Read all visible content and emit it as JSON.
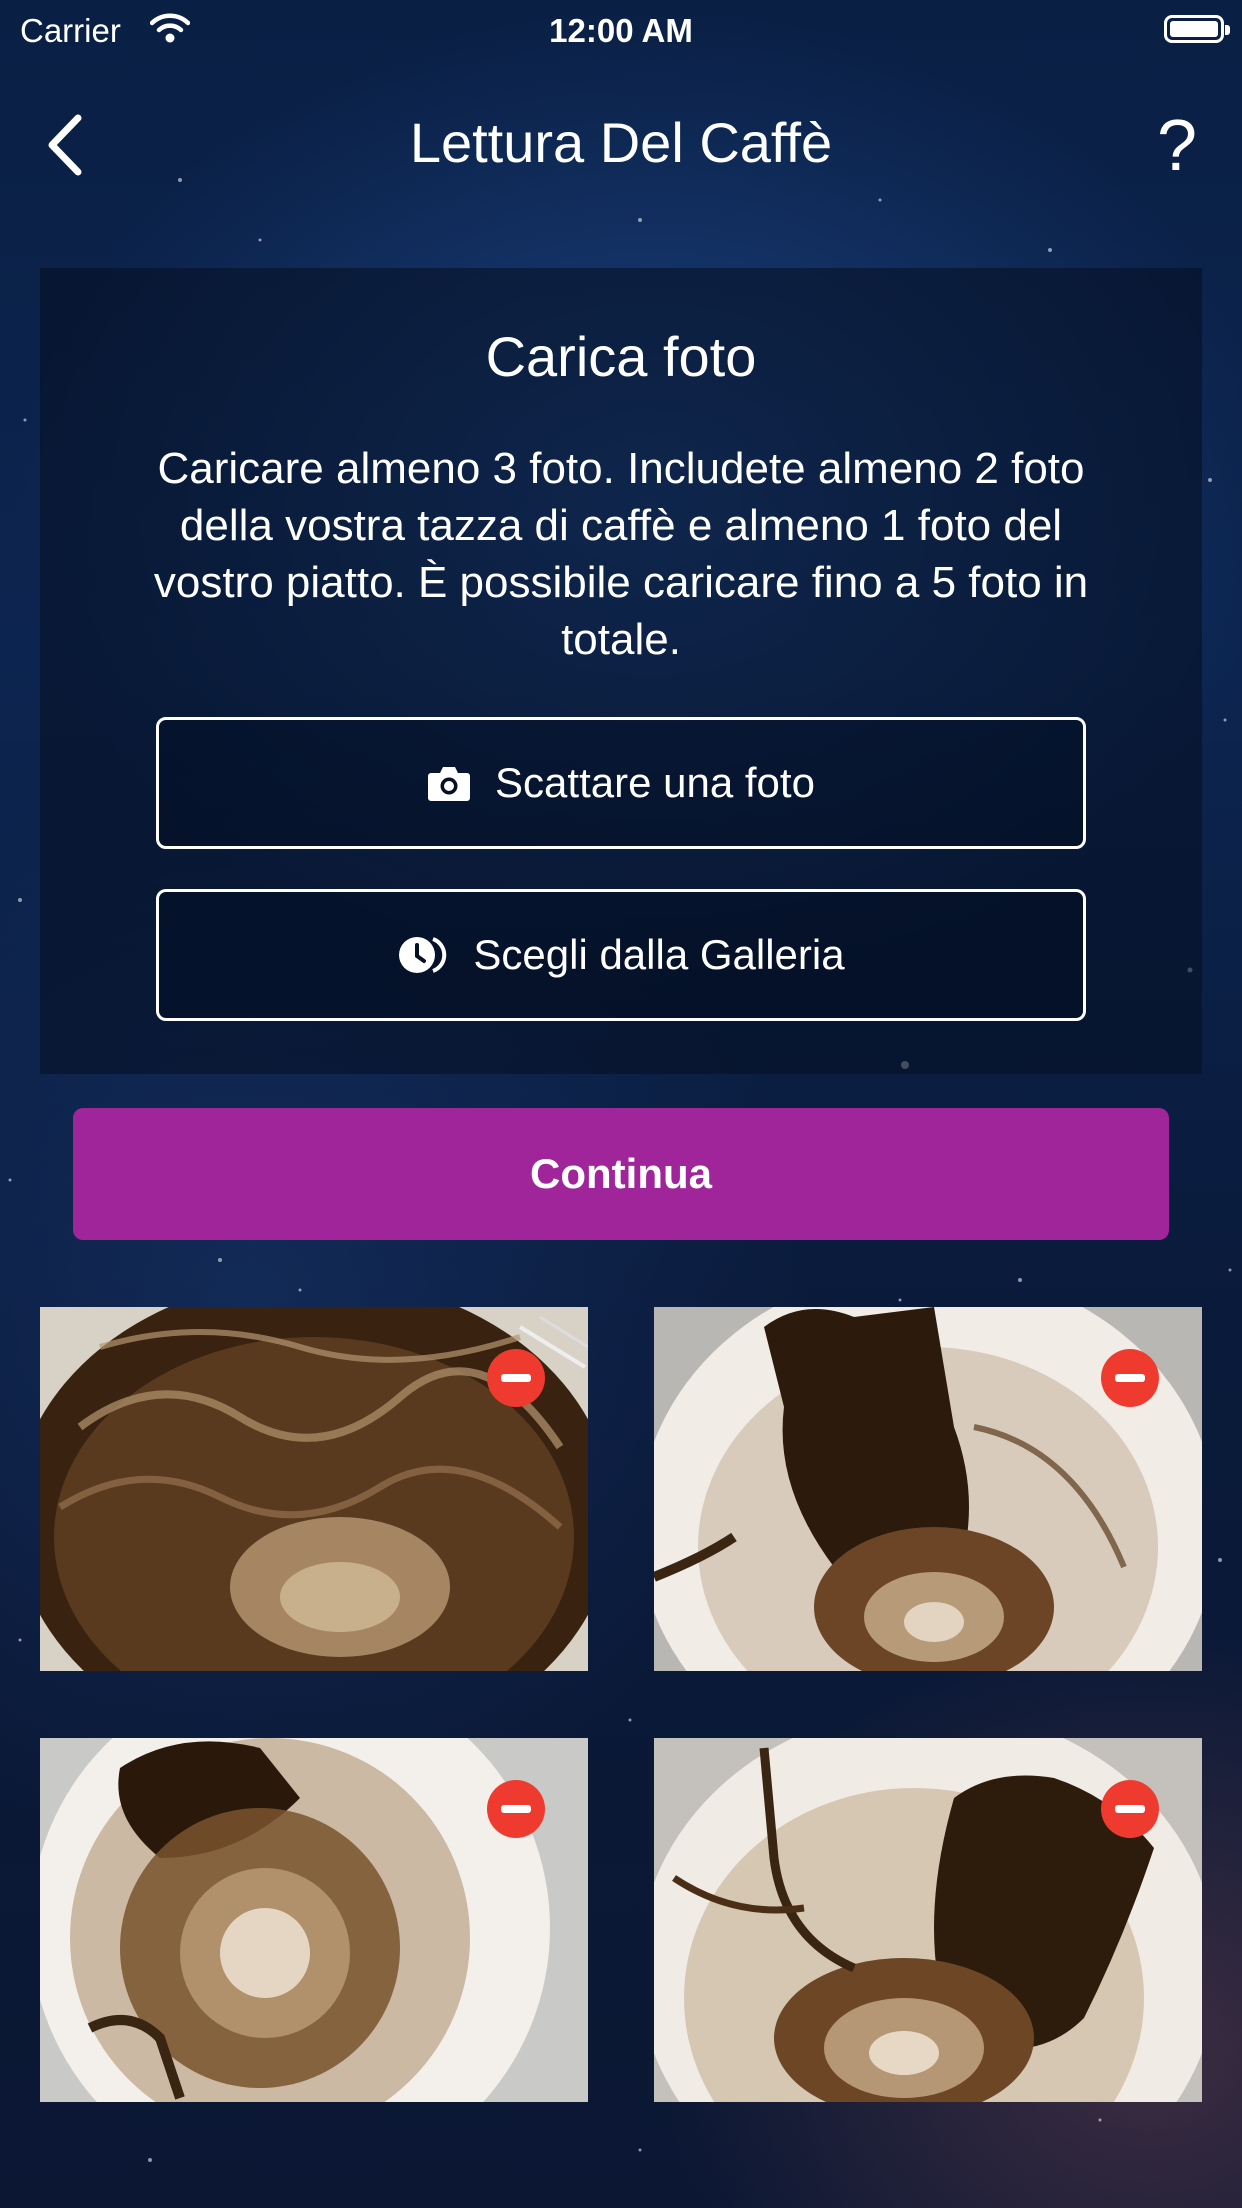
{
  "status_bar": {
    "carrier": "Carrier",
    "time": "12:00 AM"
  },
  "nav": {
    "title": "Lettura Del Caffè",
    "help_label": "?"
  },
  "upload": {
    "title": "Carica foto",
    "description": "Caricare almeno 3 foto. Includete almeno 2 foto della vostra tazza di caffè e almeno 1 foto del vostro piatto. È possibile caricare fino a 5 foto in totale.",
    "take_photo_label": "Scattare una foto",
    "gallery_label": "Scegli dalla Galleria"
  },
  "continue_label": "Continua",
  "photos": [
    {
      "name": "coffee-cup-photo-1",
      "icon": "remove-icon"
    },
    {
      "name": "coffee-cup-photo-2",
      "icon": "remove-icon"
    },
    {
      "name": "coffee-cup-photo-3",
      "icon": "remove-icon"
    },
    {
      "name": "coffee-cup-photo-4",
      "icon": "remove-icon"
    }
  ],
  "colors": {
    "accent": "#a0259a",
    "remove": "#ef3b2f"
  }
}
